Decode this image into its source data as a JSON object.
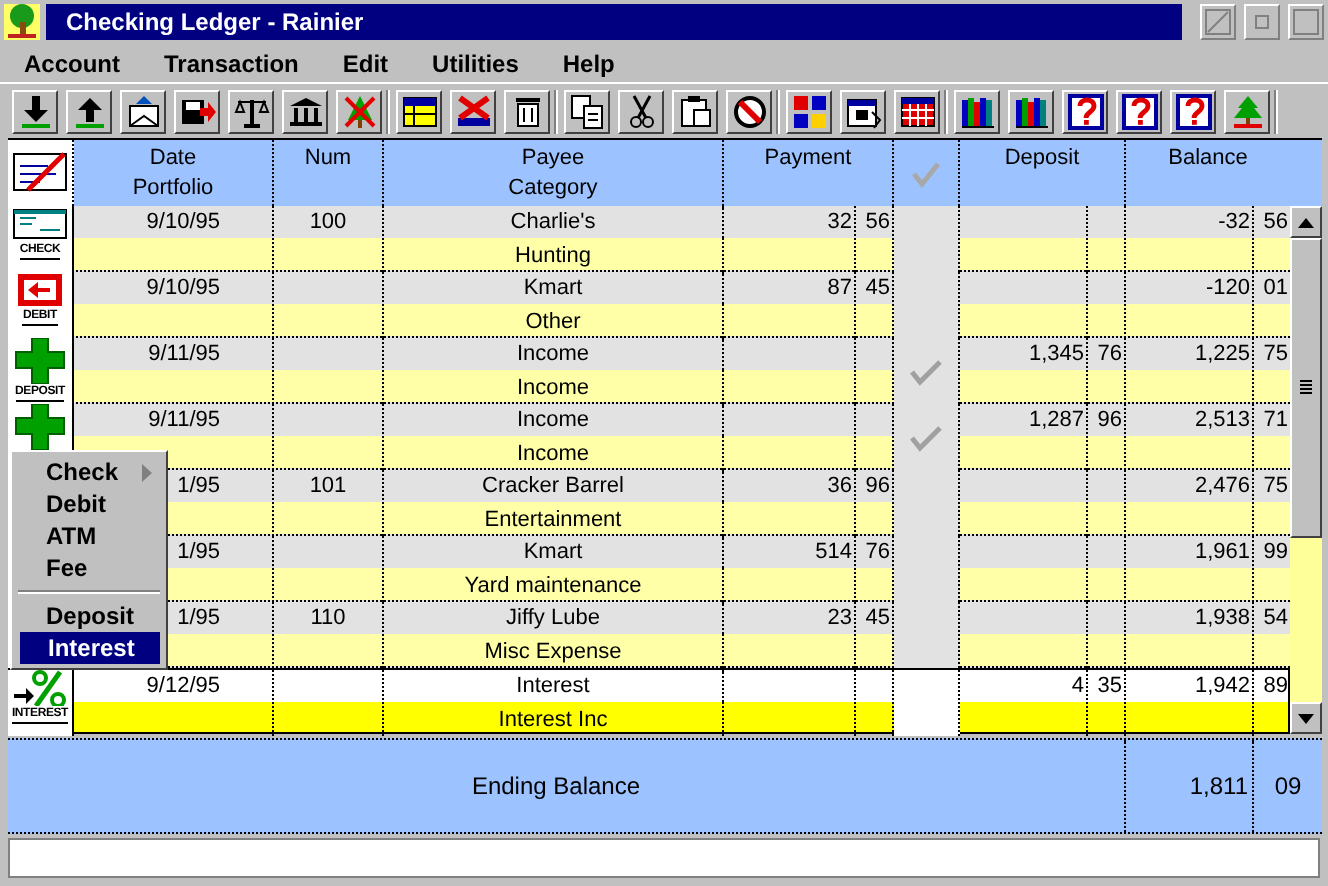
{
  "window": {
    "title": "Checking Ledger - Rainier"
  },
  "menu_bar": [
    {
      "label": "Account"
    },
    {
      "label": "Transaction"
    },
    {
      "label": "Edit"
    },
    {
      "label": "Utilities"
    },
    {
      "label": "Help"
    }
  ],
  "toolbar": [
    {
      "buttons": [
        {
          "kind": "import"
        },
        {
          "kind": "export"
        },
        {
          "kind": "envelope"
        },
        {
          "kind": "save"
        },
        {
          "kind": "scale"
        },
        {
          "kind": "bank"
        },
        {
          "kind": "crossed-tree"
        }
      ]
    },
    {
      "buttons": [
        {
          "kind": "table"
        },
        {
          "kind": "cross"
        },
        {
          "kind": "trash"
        }
      ]
    },
    {
      "buttons": [
        {
          "kind": "copy"
        },
        {
          "kind": "cut"
        },
        {
          "kind": "paste"
        },
        {
          "kind": "prohibited"
        }
      ]
    },
    {
      "buttons": [
        {
          "kind": "blocks"
        },
        {
          "kind": "calendar"
        },
        {
          "kind": "grid"
        }
      ]
    },
    {
      "buttons": [
        {
          "kind": "books"
        },
        {
          "kind": "books"
        },
        {
          "kind": "help"
        },
        {
          "kind": "help"
        },
        {
          "kind": "help"
        },
        {
          "kind": "tree"
        }
      ]
    }
  ],
  "ledger": {
    "columns": {
      "date": "Date",
      "portfolio": "Portfolio",
      "num": "Num",
      "payee": "Payee",
      "category": "Category",
      "payment": "Payment",
      "deposit": "Deposit",
      "balance": "Balance"
    },
    "rows": [
      {
        "kind": "check",
        "icon_label": "CHECK",
        "date": "9/10/95",
        "num": "100",
        "payee": "Charlie's",
        "category": "Hunting",
        "payment": {
          "dollars": "32",
          "cents": "56"
        },
        "cleared": false,
        "balance": {
          "dollars": "-32",
          "cents": "56"
        },
        "selected": false
      },
      {
        "kind": "debit",
        "icon_label": "DEBIT",
        "date": "9/10/95",
        "payee": "Kmart",
        "category": "Other",
        "payment": {
          "dollars": "87",
          "cents": "45"
        },
        "cleared": false,
        "balance": {
          "dollars": "-120",
          "cents": "01"
        },
        "selected": false
      },
      {
        "kind": "deposit",
        "icon_label": "DEPOSIT",
        "date": "9/11/95",
        "payee": "Income",
        "category": "Income",
        "cleared": true,
        "deposit": {
          "dollars": "1,345",
          "cents": "76"
        },
        "balance": {
          "dollars": "1,225",
          "cents": "75"
        },
        "selected": false
      },
      {
        "kind": "deposit",
        "date": "9/11/95",
        "payee": "Income",
        "category": "Income",
        "cleared": true,
        "deposit": {
          "dollars": "1,287",
          "cents": "96"
        },
        "balance": {
          "dollars": "2,513",
          "cents": "71"
        },
        "selected": false
      },
      {
        "date": "1/95",
        "num": "101",
        "payee": "Cracker Barrel",
        "category": "Entertainment",
        "payment": {
          "dollars": "36",
          "cents": "96"
        },
        "cleared": false,
        "balance": {
          "dollars": "2,476",
          "cents": "75"
        },
        "selected": false
      },
      {
        "date": "1/95",
        "payee": "Kmart",
        "category": "Yard maintenance",
        "payment": {
          "dollars": "514",
          "cents": "76"
        },
        "cleared": false,
        "balance": {
          "dollars": "1,961",
          "cents": "99"
        },
        "selected": false
      },
      {
        "date": "1/95",
        "num": "110",
        "payee": "Jiffy Lube",
        "category": "Misc Expense",
        "payment": {
          "dollars": "23",
          "cents": "45"
        },
        "cleared": false,
        "balance": {
          "dollars": "1,938",
          "cents": "54"
        },
        "selected": false
      },
      {
        "kind": "interest",
        "icon_label": "INTEREST",
        "date": "9/12/95",
        "payee": "Interest",
        "category": "Interest Inc",
        "cleared": false,
        "deposit": {
          "dollars": "4",
          "cents": "35"
        },
        "balance": {
          "dollars": "1,942",
          "cents": "89"
        },
        "selected": true
      }
    ],
    "ending_balance": {
      "label": "Ending Balance",
      "dollars": "1,811",
      "cents": "09"
    }
  },
  "context_menu": {
    "items": [
      {
        "kind": "item",
        "label": "Check",
        "submenu": true,
        "selected": false
      },
      {
        "kind": "item",
        "label": "Debit",
        "submenu": false,
        "selected": false
      },
      {
        "kind": "item",
        "label": "ATM",
        "submenu": false,
        "selected": false
      },
      {
        "kind": "item",
        "label": "Fee",
        "submenu": false,
        "selected": false
      },
      {
        "kind": "separator"
      },
      {
        "kind": "item",
        "label": "Deposit",
        "submenu": false,
        "selected": false
      },
      {
        "kind": "item",
        "label": "Interest",
        "submenu": false,
        "selected": true
      }
    ]
  }
}
